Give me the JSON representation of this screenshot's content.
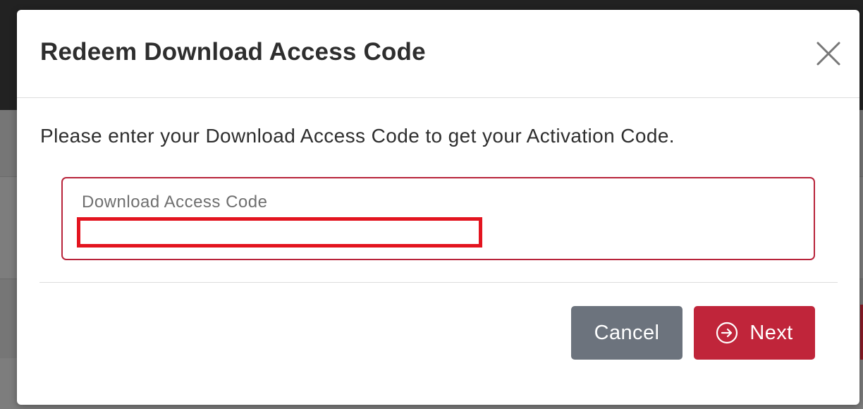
{
  "modal": {
    "title": "Redeem Download Access Code",
    "close_icon": "close-icon",
    "intro_text": "Please enter your Download Access Code to get your Activation Code.",
    "field": {
      "label": "Download Access Code",
      "value": ""
    },
    "buttons": {
      "cancel_label": "Cancel",
      "next_label": "Next",
      "next_icon": "arrow-circle-right-icon"
    }
  },
  "colors": {
    "accent": "#c0253a",
    "field_border": "#b8233a",
    "input_highlight": "#e3141f",
    "cancel_button": "#6c737d",
    "title_text": "#2e2e2e",
    "overlay_dark": "#222222"
  }
}
